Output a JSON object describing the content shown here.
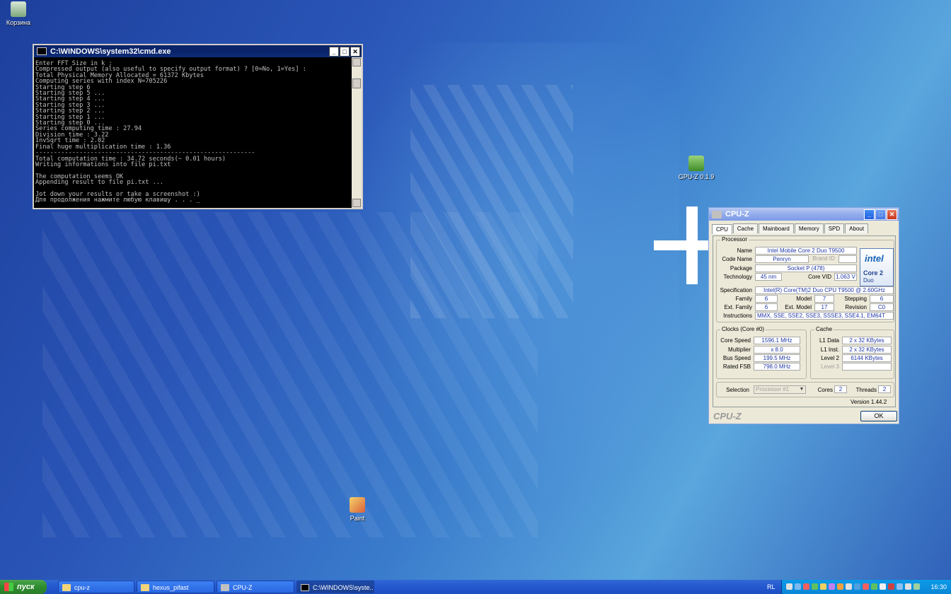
{
  "desktop": {
    "icons": [
      {
        "label": "Корзина"
      },
      {
        "label": "GPU-Z 0.1.9"
      },
      {
        "label": "Paint"
      }
    ]
  },
  "cmd": {
    "title": "C:\\WINDOWS\\system32\\cmd.exe",
    "lines": [
      "Enter FFT Size in k :",
      "Compressed output (also useful to specify output format) ? [0=No, 1=Yes] :",
      "Total Physical Memory Allocated = 61372 Kbytes",
      "Computing series with index N=705226",
      "Starting step 6",
      "Starting step 5 ...",
      "Starting step 4 ...",
      "Starting step 3 ...",
      "Starting step 2 ...",
      "Starting step 1 ...",
      "Starting step 0 ...",
      "Series computing time : 27.94",
      "Division time : 3.22",
      "InvSqrt time : 2.02",
      "Final huge multiplication time : 1.36",
      "------------------------------------------------------------",
      "Total computation time : 34.72 seconds(~ 0.01 hours)",
      "Writing informations into file pi.txt",
      "",
      "The computation seems OK",
      "Appending result to file pi.txt ...",
      "",
      "Jot down your results or take a screenshot :)",
      "Для продолжения нажмите любую клавишу . . . _"
    ]
  },
  "cpuz": {
    "title": "CPU-Z",
    "tabs": [
      "CPU",
      "Cache",
      "Mainboard",
      "Memory",
      "SPD",
      "About"
    ],
    "processor": {
      "group": "Processor",
      "name_label": "Name",
      "name": "Intel Mobile Core 2 Duo T9500",
      "codename_label": "Code Name",
      "codename": "Penryn",
      "brandid_label": "Brand ID",
      "package_label": "Package",
      "package": "Socket P (478)",
      "technology_label": "Technology",
      "technology": "45 nm",
      "corevid_label": "Core VID",
      "corevid": "1.063 V",
      "spec_label": "Specification",
      "spec": "Intel(R) Core(TM)2 Duo CPU     T9500  @ 2.60GHz",
      "family_label": "Family",
      "family": "6",
      "model_label": "Model",
      "model": "7",
      "stepping_label": "Stepping",
      "stepping": "6",
      "extfamily_label": "Ext. Family",
      "extfamily": "6",
      "extmodel_label": "Ext. Model",
      "extmodel": "17",
      "revision_label": "Revision",
      "revision": "C0",
      "instructions_label": "Instructions",
      "instructions": "MMX, SSE, SSE2, SSE3, SSSE3, SSE4.1, EM64T"
    },
    "logo": {
      "brand": "intel",
      "line1": "Core 2",
      "line2": "Duo"
    },
    "clocks": {
      "group": "Clocks (Core #0)",
      "corespeed_label": "Core Speed",
      "corespeed": "1596.1 MHz",
      "multiplier_label": "Multiplier",
      "multiplier": "x 8.0",
      "busspeed_label": "Bus Speed",
      "busspeed": "199.5 MHz",
      "ratedfsb_label": "Rated FSB",
      "ratedfsb": "798.0 MHz"
    },
    "cache": {
      "group": "Cache",
      "l1data_label": "L1 Data",
      "l1data": "2 x 32 KBytes",
      "l1inst_label": "L1 Inst.",
      "l1inst": "2 x 32 KBytes",
      "level2_label": "Level 2",
      "level2": "6144 KBytes",
      "level3_label": "Level 3"
    },
    "selection_label": "Selection",
    "selection": "Processor #1",
    "cores_label": "Cores",
    "cores": "2",
    "threads_label": "Threads",
    "threads": "2",
    "version": "Version 1.44.2",
    "footer": "CPU-Z",
    "ok": "OK"
  },
  "taskbar": {
    "start": "пуск",
    "tasks": [
      "cpu-z",
      "hexus_pifast",
      "CPU-Z",
      "C:\\WINDOWS\\syste..."
    ],
    "lang": "RL",
    "clock": "16:30"
  }
}
